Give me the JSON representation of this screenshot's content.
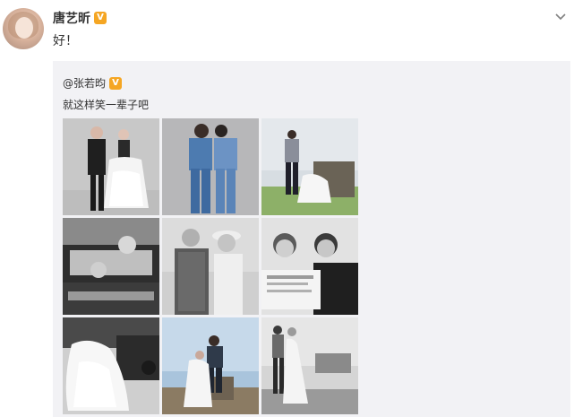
{
  "post": {
    "author": "唐艺昕",
    "verified_badge": "V",
    "text": "好！",
    "menu_icon": "chevron-down-icon"
  },
  "repost": {
    "author": "@张若昀",
    "verified_badge": "V",
    "text": "就这样笑一辈子吧",
    "photos": [
      "wedding-photo-1",
      "wedding-photo-2",
      "wedding-photo-3",
      "wedding-photo-4",
      "wedding-photo-5",
      "wedding-photo-6",
      "wedding-photo-7",
      "wedding-photo-8",
      "wedding-photo-9"
    ]
  },
  "colors": {
    "name_text": "#333333",
    "repost_bg": "#f2f2f5",
    "badge": "#f5a623"
  }
}
